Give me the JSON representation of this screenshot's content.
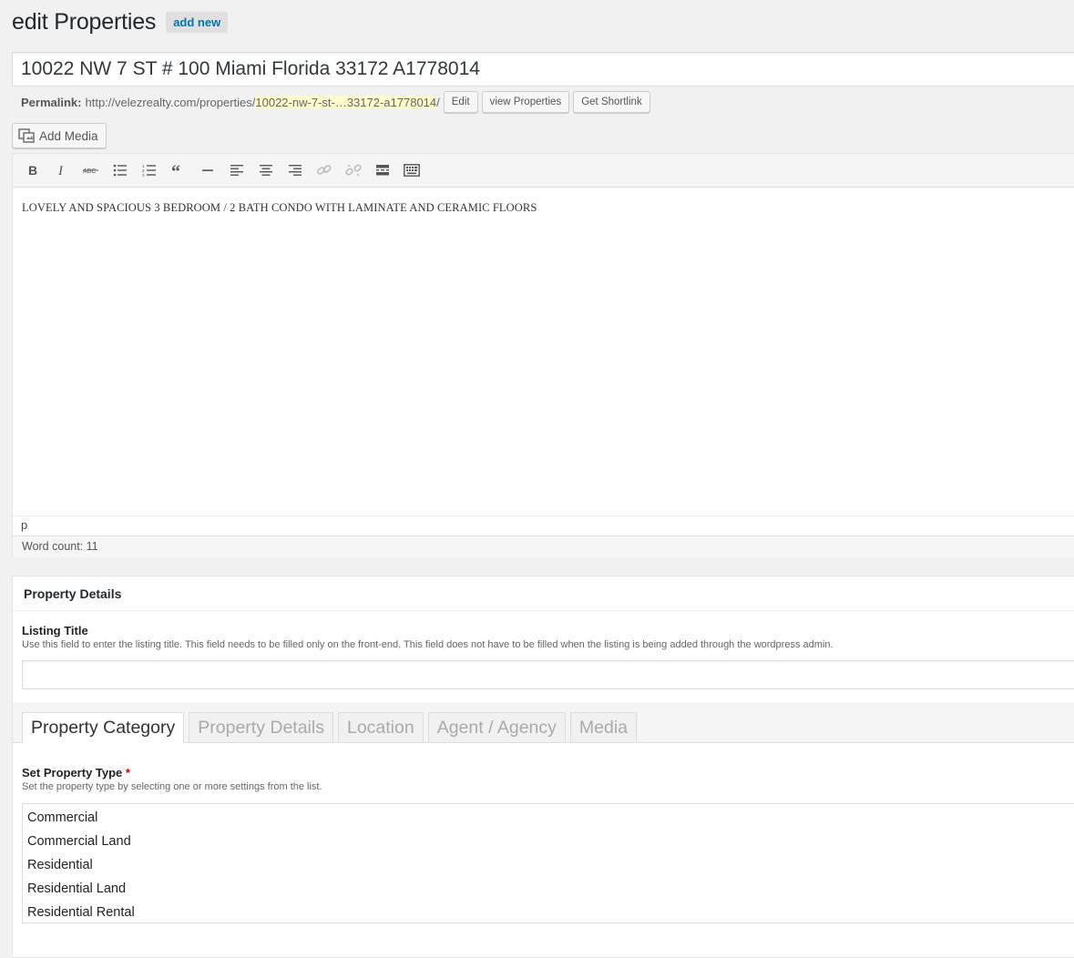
{
  "header": {
    "title": "edit Properties",
    "add_new": "add new"
  },
  "post_title": "10022 NW 7 ST # 100 Miami Florida 33172 A1778014",
  "permalink": {
    "label": "Permalink:",
    "base": "http://velezrealty.com/properties/",
    "slug": "10022-nw-7-st-…33172-a1778014",
    "trailing": "/",
    "edit": "Edit",
    "view": "view Properties",
    "shortlink": "Get Shortlink"
  },
  "add_media": "Add Media",
  "toolbar": {
    "icons": [
      "bold-icon",
      "italic-icon",
      "strikethrough-icon",
      "bulleted-list-icon",
      "numbered-list-icon",
      "blockquote-icon",
      "horizontal-line-icon",
      "align-left-icon",
      "align-center-icon",
      "align-right-icon",
      "link-icon",
      "unlink-icon",
      "read-more-icon",
      "toolbar-toggle-icon"
    ]
  },
  "editor": {
    "content": "LOVELY AND SPACIOUS 3 BEDROOM / 2 BATH CONDO WITH LAMINATE AND CERAMIC FLOORS",
    "path": "p",
    "word_count": "Word count: 11"
  },
  "metabox": {
    "title": "Property Details",
    "listing_title": {
      "label": "Listing Title",
      "desc": "Use this field to enter the listing title. This field needs to be filled only on the front-end. This field does not have to be filled when the listing is being added through the wordpress admin.",
      "value": ""
    },
    "tabs": [
      {
        "label": "Property Category"
      },
      {
        "label": "Property Details"
      },
      {
        "label": "Location"
      },
      {
        "label": "Agent / Agency"
      },
      {
        "label": "Media"
      }
    ],
    "active_tab": "Property Category",
    "property_type": {
      "label": "Set Property Type",
      "required_mark": "*",
      "desc": "Set the property type by selecting one or more settings from the list.",
      "options": [
        "Commercial",
        "Commercial Land",
        "Residential",
        "Residential Land",
        "Residential Rental"
      ]
    }
  }
}
